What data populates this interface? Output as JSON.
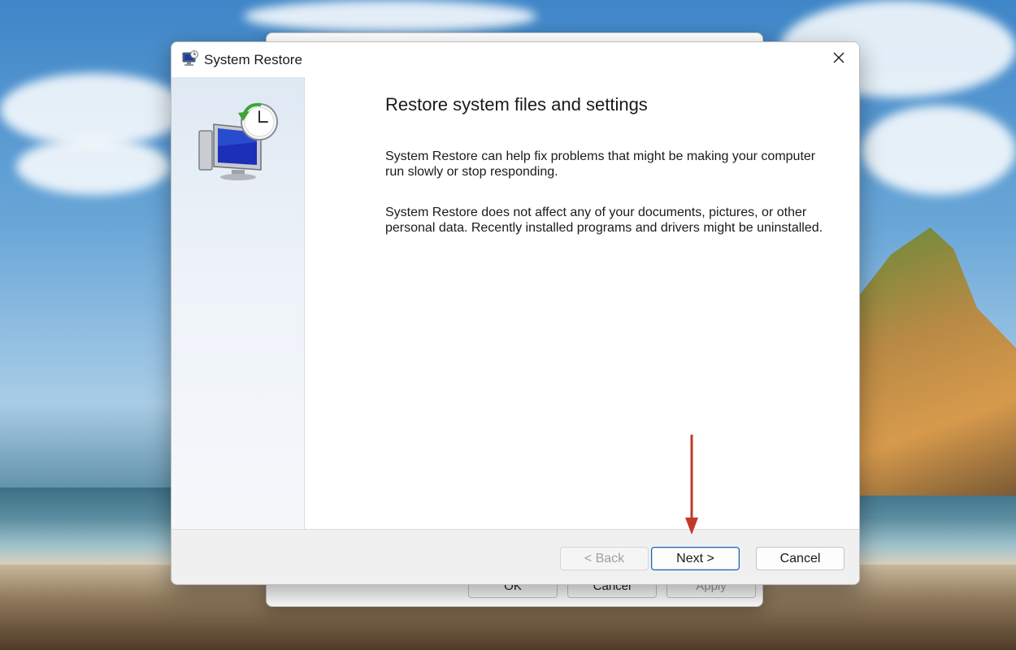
{
  "dialog": {
    "title": "System Restore",
    "heading": "Restore system files and settings",
    "paragraph1": "System Restore can help fix problems that might be making your computer run slowly or stop responding.",
    "paragraph2": "System Restore does not affect any of your documents, pictures, or other personal data. Recently installed programs and drivers might be uninstalled.",
    "buttons": {
      "back": "< Back",
      "next": "Next >",
      "cancel": "Cancel"
    },
    "icons": {
      "title": "system-restore-icon",
      "close": "close-icon",
      "illustration": "monitor-clock-restore-icon"
    }
  },
  "background_window": {
    "buttons": {
      "ok": "OK",
      "cancel": "Cancel",
      "apply": "Apply"
    }
  },
  "annotation": {
    "arrow_color": "#c0392b",
    "points_to": "next-button"
  },
  "colors": {
    "accent": "#1c5fb5",
    "side_panel": "#dfe9f3",
    "footer": "#f0f0f0"
  }
}
